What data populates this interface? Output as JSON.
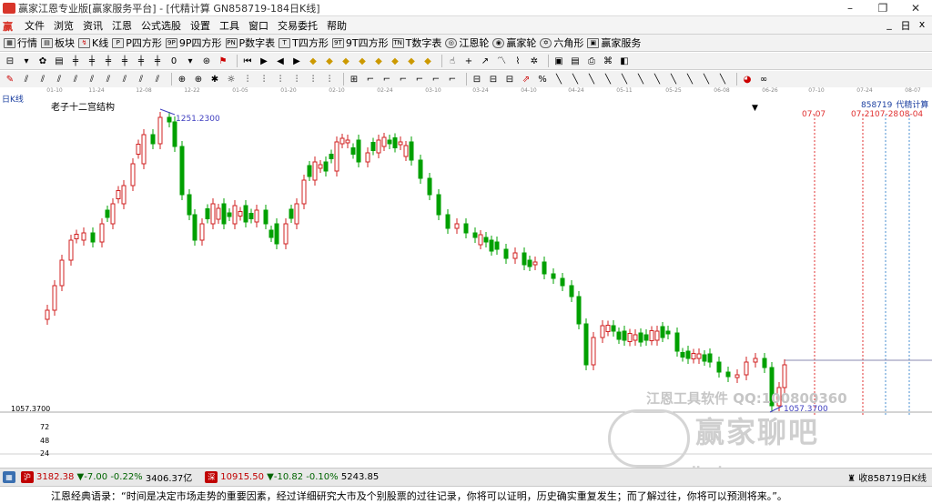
{
  "window": {
    "title": "赢家江恩专业版[赢家服务平台] - [代精计算 GN858719-184日K线]",
    "controls": [
      "–",
      "❐",
      "✕"
    ]
  },
  "menu": {
    "items": [
      "文件",
      "浏览",
      "资讯",
      "江恩",
      "公式选股",
      "设置",
      "工具",
      "窗口",
      "交易委托",
      "帮助"
    ],
    "right": [
      "_",
      "日",
      "x"
    ]
  },
  "toolbar": {
    "items": [
      {
        "label": "行情",
        "icon": "grid-icon"
      },
      {
        "label": "板块",
        "icon": "blocks-icon"
      },
      {
        "label": "K线",
        "icon": "candle-icon"
      },
      {
        "label": "P四方形",
        "icon": "p-square-icon"
      },
      {
        "label": "9P四方形",
        "icon": "9p-square-icon"
      },
      {
        "label": "P数字表",
        "icon": "p-table-icon"
      },
      {
        "label": "T四方形",
        "icon": "t-square-icon"
      },
      {
        "label": "9T四方形",
        "icon": "9t-square-icon"
      },
      {
        "label": "T数字表",
        "icon": "t-table-icon"
      },
      {
        "label": "江恩轮",
        "icon": "gann-wheel-icon"
      },
      {
        "label": "赢家轮",
        "icon": "winner-wheel-icon"
      },
      {
        "label": "六角形",
        "icon": "hexagon-icon"
      },
      {
        "label": "赢家服务",
        "icon": "service-icon"
      }
    ]
  },
  "chart": {
    "period_label": "日K线",
    "pattern_name": "老子十二宫结构",
    "code": "858719",
    "name": "代精计算",
    "high_label": "1251.2300",
    "low_label": "1057.3700",
    "ylabels": [
      "1057.3700",
      "72",
      "48",
      "24"
    ],
    "future_dates": [
      "07-07",
      "07-21",
      "07-28",
      "08-04"
    ],
    "date_ticks": [
      "01-10",
      "11-24",
      "12-08",
      "12-22",
      "01-05",
      "01-20",
      "02-10",
      "02-24",
      "03-10",
      "03-24",
      "04-10",
      "04-24",
      "05-11",
      "05-25",
      "06-08",
      "06-26",
      "07-10",
      "07-24",
      "08-07"
    ]
  },
  "watermark": {
    "line1": "江恩工具软件 QQ:100800360",
    "line2": "赢家聊吧",
    "line3": "jiaoba"
  },
  "status": {
    "index1": {
      "value": "3182.38",
      "change": "▼-7.00",
      "pct": "-0.22%",
      "amount": "3406.37亿"
    },
    "index2": {
      "value": "10915.50",
      "change": "▼-10.82",
      "pct": "-0.10%",
      "amount": "5243.85"
    },
    "right_text": "收858719日K线"
  },
  "quote": {
    "text": "江恩经典语录：“时间是决定市场走势的重要因素，经过详细研究大市及个别股票的过往记录，你将可以证明，历史确实重复发生；而了解过往，你将可以预测将来。”。"
  },
  "chart_data": {
    "type": "candlestick",
    "note_high": 1251.23,
    "note_low": 1057.37,
    "colors": {
      "up": "#d02020",
      "down": "#00a000",
      "support": "#4040c0"
    }
  }
}
